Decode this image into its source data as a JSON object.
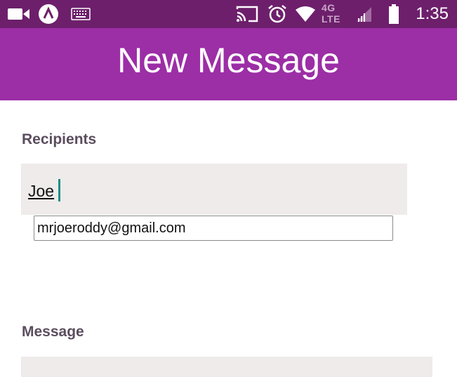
{
  "status_bar": {
    "time": "1:35",
    "network_label": "4G LTE",
    "icons": [
      "video-camera-icon",
      "app-a-icon",
      "keyboard-icon",
      "cast-icon",
      "alarm-icon",
      "wifi-icon",
      "signal-icon",
      "battery-icon"
    ]
  },
  "app_bar": {
    "title": "New Message"
  },
  "recipients": {
    "label": "Recipients",
    "value": "Joe",
    "suggestion": "mrjoeroddy@gmail.com"
  },
  "message": {
    "label": "Message",
    "value": ""
  },
  "colors": {
    "status_bar": "#6d1f6b",
    "app_bar": "#9c2ea6",
    "field_bg": "#eeebea",
    "label": "#5b4d5e",
    "cursor": "#1a8f85"
  }
}
